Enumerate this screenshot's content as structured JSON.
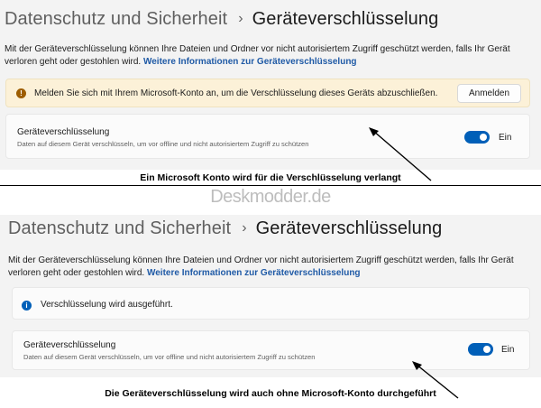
{
  "top": {
    "breadcrumb": {
      "parent": "Datenschutz und Sicherheit",
      "separator": "›",
      "current": "Geräteverschlüsselung"
    },
    "description": "Mit der Geräteverschlüsselung können Ihre Dateien und Ordner vor nicht autorisiertem Zugriff geschützt werden, falls Ihr Gerät verloren geht oder gestohlen wird.",
    "link": "Weitere Informationen zur Geräteverschlüsselung",
    "warning": {
      "icon": "warning-icon",
      "text": "Melden Sie sich mit Ihrem Microsoft-Konto an, um die Verschlüsselung dieses Geräts abzuschließen.",
      "button": "Anmelden"
    },
    "setting": {
      "title": "Geräteverschlüsselung",
      "subtitle": "Daten auf diesem Gerät verschlüsseln, um vor offline und nicht autorisiertem Zugriff zu schützen",
      "toggle_label": "Ein",
      "toggle_on": true
    },
    "caption": "Ein Microsoft Konto wird für die Verschlüsselung verlangt"
  },
  "watermark": "Deskmodder.de",
  "bottom": {
    "breadcrumb": {
      "parent": "Datenschutz und Sicherheit",
      "separator": "›",
      "current": "Geräteverschlüsselung"
    },
    "description": "Mit der Geräteverschlüsselung können Ihre Dateien und Ordner vor nicht autorisiertem Zugriff geschützt werden, falls Ihr Gerät verloren geht oder gestohlen wird.",
    "link": "Weitere Informationen zur Geräteverschlüsselung",
    "info": {
      "icon": "info-icon",
      "text": "Verschlüsselung wird ausgeführt."
    },
    "setting": {
      "title": "Geräteverschlüsselung",
      "subtitle": "Daten auf diesem Gerät verschlüsseln, um vor offline und nicht autorisiertem Zugriff zu schützen",
      "toggle_label": "Ein",
      "toggle_on": true
    },
    "caption": "Die Geräteverschlüsselung wird auch ohne Microsoft-Konto durchgeführt"
  },
  "colors": {
    "accent": "#005fb8",
    "link": "#1f5aa6",
    "warning_bg": "#fcf1d8",
    "warning_icon": "#9d5d00",
    "panel_bg": "#f3f3f3"
  }
}
